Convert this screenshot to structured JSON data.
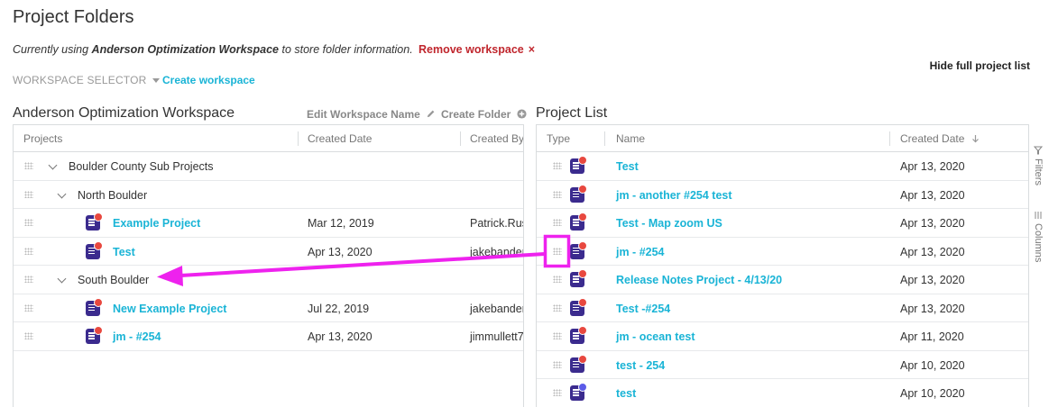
{
  "header": {
    "title": "Project Folders",
    "ws_prefix": "Currently using ",
    "ws_name_bold": "Anderson Optimization Workspace",
    "ws_suffix": " to store folder information.",
    "remove_label": "Remove workspace",
    "remove_x": "×",
    "hide_list_label": "Hide full project list",
    "ws_selector_label": "WORKSPACE SELECTOR",
    "create_ws_label": "Create workspace"
  },
  "workspace": {
    "name": "Anderson Optimization Workspace",
    "edit_label": "Edit Workspace Name",
    "create_folder_label": "Create Folder",
    "columns": [
      "Projects",
      "Created Date",
      "Created By"
    ],
    "rows": [
      {
        "type": "folder",
        "level": 0,
        "label": "Boulder County Sub Projects",
        "date": "",
        "by": ""
      },
      {
        "type": "folder",
        "level": 1,
        "label": "North Boulder",
        "date": "",
        "by": ""
      },
      {
        "type": "project",
        "level": 2,
        "label": "Example Project",
        "date": "Mar 12, 2019",
        "by": "Patrick.Rus"
      },
      {
        "type": "project",
        "level": 2,
        "label": "Test",
        "date": "Apr 13, 2020",
        "by": "jakebander"
      },
      {
        "type": "folder",
        "level": 1,
        "label": "South Boulder",
        "date": "",
        "by": ""
      },
      {
        "type": "project",
        "level": 2,
        "label": "New Example Project",
        "date": "Jul 22, 2019",
        "by": "jakebander"
      },
      {
        "type": "project",
        "level": 2,
        "label": "jm - #254",
        "date": "Apr 13, 2020",
        "by": "jimmullett7"
      }
    ]
  },
  "project_list": {
    "title": "Project List",
    "columns": [
      "Type",
      "Name",
      "Created Date"
    ],
    "sort_icon": "arrow-down-icon",
    "rows": [
      {
        "name": "Test",
        "date": "Apr 13, 2020",
        "icon_badge": "#e8483f"
      },
      {
        "name": "jm - another #254 test",
        "date": "Apr 13, 2020",
        "icon_badge": "#e8483f"
      },
      {
        "name": "Test - Map zoom US",
        "date": "Apr 13, 2020",
        "icon_badge": "#e8483f"
      },
      {
        "name": "jm - #254",
        "date": "Apr 13, 2020",
        "icon_badge": "#e8483f"
      },
      {
        "name": "Release Notes Project - 4/13/20",
        "date": "Apr 13, 2020",
        "icon_badge": "#e8483f"
      },
      {
        "name": "Test -#254",
        "date": "Apr 13, 2020",
        "icon_badge": "#e8483f"
      },
      {
        "name": "jm - ocean test",
        "date": "Apr 11, 2020",
        "icon_badge": "#e8483f"
      },
      {
        "name": "test - 254",
        "date": "Apr 10, 2020",
        "icon_badge": "#e8483f"
      },
      {
        "name": "test",
        "date": "Apr 10, 2020",
        "icon_badge": "#5b5be8"
      }
    ],
    "side_tabs": [
      "Filters",
      "Columns"
    ]
  },
  "colors": {
    "link": "#1ab4d6",
    "remove": "#c0262d",
    "annotation": "#ee22ee"
  }
}
